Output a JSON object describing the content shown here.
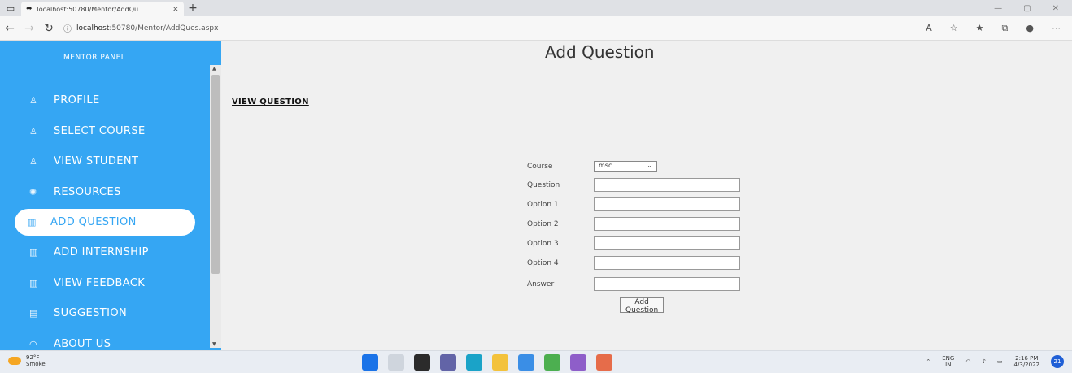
{
  "browser": {
    "tab_title": "localhost:50780/Mentor/AddQu",
    "tab_close": "×",
    "new_tab": "+",
    "url_host": "localhost",
    "url_rest": ":50780/Mentor/AddQues.aspx"
  },
  "sidebar": {
    "panel_title": "MENTOR PANEL",
    "items": [
      {
        "label": "PROFILE",
        "icon": "user-icon"
      },
      {
        "label": "SELECT COURSE",
        "icon": "user-icon"
      },
      {
        "label": "VIEW STUDENT",
        "icon": "user-icon"
      },
      {
        "label": "RESOURCES",
        "icon": "gear-icon"
      },
      {
        "label": "ADD QUESTION",
        "icon": "map-icon",
        "active": true
      },
      {
        "label": "ADD INTERNSHIP",
        "icon": "map-icon"
      },
      {
        "label": "VIEW FEEDBACK",
        "icon": "map-icon"
      },
      {
        "label": "SUGGESTION",
        "icon": "document-icon"
      },
      {
        "label": "ABOUT US",
        "icon": "info-icon"
      }
    ]
  },
  "main": {
    "title": "Add Question",
    "view_link": "VIEW QUESTION",
    "form": {
      "course_label": "Course",
      "course_value": "msc",
      "question_label": "Question",
      "option1_label": "Option 1",
      "option2_label": "Option 2",
      "option3_label": "Option 3",
      "option4_label": "Option 4",
      "answer_label": "Answer",
      "submit_label": "Add Question"
    }
  },
  "taskbar": {
    "temperature": "92°F",
    "weather": "Smoke",
    "lang_top": "ENG",
    "lang_bottom": "IN",
    "time": "2:16 PM",
    "date": "4/3/2022",
    "notifications": "21"
  },
  "colors": {
    "sidebar": "#35a6f3",
    "active_item_bg": "#ffffff"
  }
}
